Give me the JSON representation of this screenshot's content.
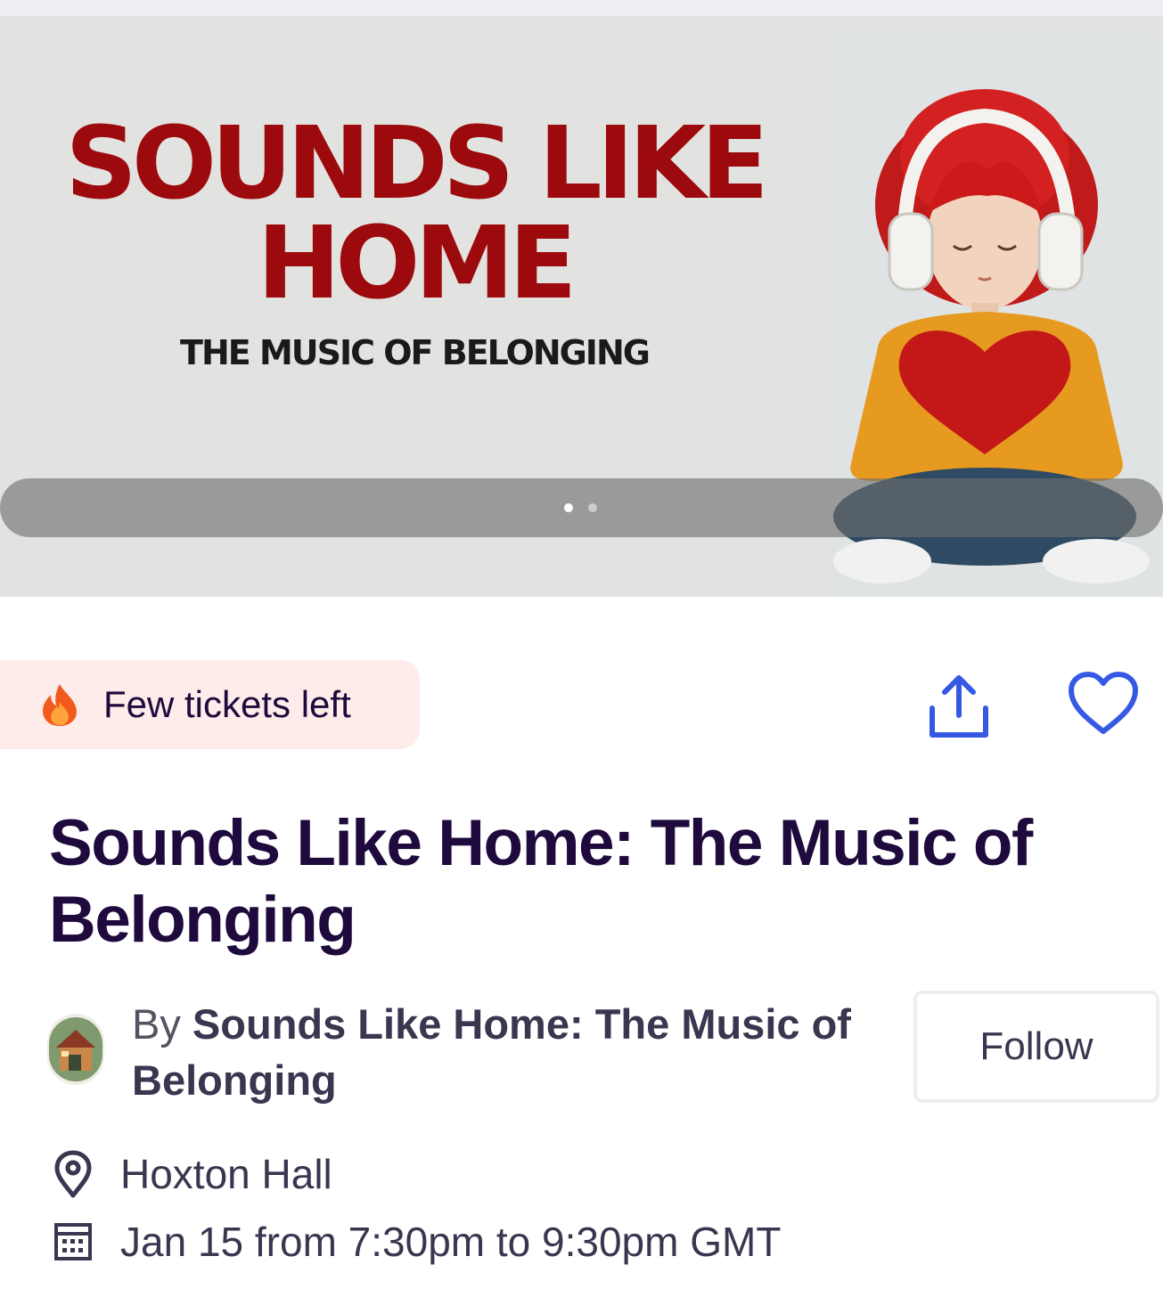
{
  "banner": {
    "title_line1": "SOUNDS LIKE",
    "title_line2": "HOME",
    "subtitle": "THE MUSIC OF BELONGING",
    "artwork": "knitted-doll-with-headphones-holding-heart",
    "carousel": {
      "slides": 2,
      "active": 1
    }
  },
  "badge": {
    "icon": "fire-icon",
    "label": "Few tickets left"
  },
  "actions": {
    "share_icon": "share-icon",
    "like_icon": "heart-icon",
    "accent_color": "#3659e3"
  },
  "event": {
    "title": "Sounds Like Home: The Music of Belonging",
    "organizer_prefix": "By",
    "organizer_name": "Sounds Like Home: The Music of Belonging",
    "follow_label": "Follow",
    "location": "Hoxton Hall",
    "datetime": "Jan 15 from 7:30pm to 9:30pm GMT"
  },
  "colors": {
    "banner_title": "#9c0a0d",
    "heading": "#1e0a3c",
    "badge_bg": "#fdecea"
  }
}
